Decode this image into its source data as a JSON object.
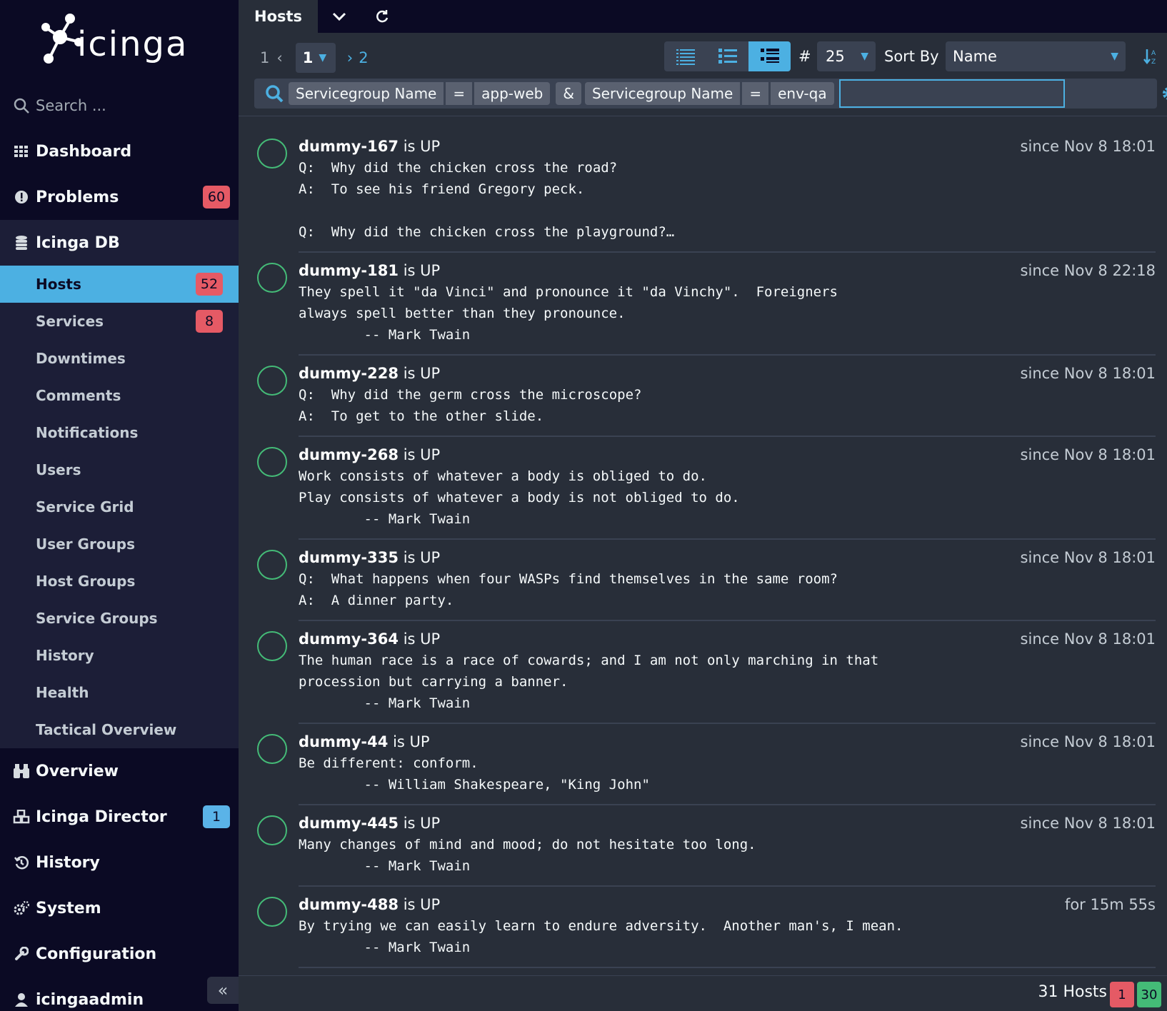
{
  "app": {
    "logo_text": "icinga"
  },
  "search": {
    "placeholder": "Search ..."
  },
  "nav": {
    "dashboard": "Dashboard",
    "problems": {
      "label": "Problems",
      "badge": "60"
    },
    "icingadb": "Icinga DB",
    "sub": [
      {
        "label": "Hosts",
        "badge": "52",
        "active": true
      },
      {
        "label": "Services",
        "badge": "8"
      },
      {
        "label": "Downtimes"
      },
      {
        "label": "Comments"
      },
      {
        "label": "Notifications"
      },
      {
        "label": "Users"
      },
      {
        "label": "Service Grid"
      },
      {
        "label": "User Groups"
      },
      {
        "label": "Host Groups"
      },
      {
        "label": "Service Groups"
      },
      {
        "label": "History"
      },
      {
        "label": "Health"
      },
      {
        "label": "Tactical Overview"
      }
    ],
    "overview": "Overview",
    "director": {
      "label": "Icinga Director",
      "badge": "1"
    },
    "history": "History",
    "system": "System",
    "configuration": "Configuration",
    "user": "icingaadmin"
  },
  "tab": {
    "title": "Hosts"
  },
  "pager": {
    "first": "1",
    "current": "1",
    "next_page": "2"
  },
  "limit": {
    "label": "#",
    "value": "25"
  },
  "sort": {
    "label": "Sort By",
    "value": "Name"
  },
  "filter": {
    "chips": [
      {
        "col": "Servicegroup Name",
        "op": "=",
        "val": "app-web"
      },
      {
        "col": "Servicegroup Name",
        "op": "=",
        "val": "env-qa"
      }
    ],
    "conj": "&",
    "input_value": ""
  },
  "hosts": [
    {
      "name": "dummy-167",
      "state": "is UP",
      "since": "since Nov 8 18:01",
      "output": "Q:\tWhy did the chicken cross the road?\nA:\tTo see his friend Gregory peck.\n\nQ:\tWhy did the chicken cross the playground?…"
    },
    {
      "name": "dummy-181",
      "state": "is UP",
      "since": "since Nov 8 22:18",
      "output": "They spell it \"da Vinci\" and pronounce it \"da Vinchy\".  Foreigners\nalways spell better than they pronounce.\n\t\t-- Mark Twain"
    },
    {
      "name": "dummy-228",
      "state": "is UP",
      "since": "since Nov 8 18:01",
      "output": "Q:\tWhy did the germ cross the microscope?\nA:\tTo get to the other slide."
    },
    {
      "name": "dummy-268",
      "state": "is UP",
      "since": "since Nov 8 18:01",
      "output": "Work consists of whatever a body is obliged to do.\nPlay consists of whatever a body is not obliged to do.\n\t\t-- Mark Twain"
    },
    {
      "name": "dummy-335",
      "state": "is UP",
      "since": "since Nov 8 18:01",
      "output": "Q:\tWhat happens when four WASPs find themselves in the same room?\nA:\tA dinner party."
    },
    {
      "name": "dummy-364",
      "state": "is UP",
      "since": "since Nov 8 18:01",
      "output": "The human race is a race of cowards; and I am not only marching in that\nprocession but carrying a banner.\n\t\t-- Mark Twain"
    },
    {
      "name": "dummy-44",
      "state": "is UP",
      "since": "since Nov 8 18:01",
      "output": "Be different: conform.\n\t\t-- William Shakespeare, \"King John\""
    },
    {
      "name": "dummy-445",
      "state": "is UP",
      "since": "since Nov 8 18:01",
      "output": "Many changes of mind and mood; do not hesitate too long.\n\t\t-- Mark Twain"
    },
    {
      "name": "dummy-488",
      "state": "is UP",
      "since": "for 15m 55s",
      "output": "By trying we can easily learn to endure adversity.  Another man's, I mean.\n\t\t-- Mark Twain"
    }
  ],
  "footer": {
    "count": "31 Hosts",
    "down": "1",
    "up": "30"
  }
}
